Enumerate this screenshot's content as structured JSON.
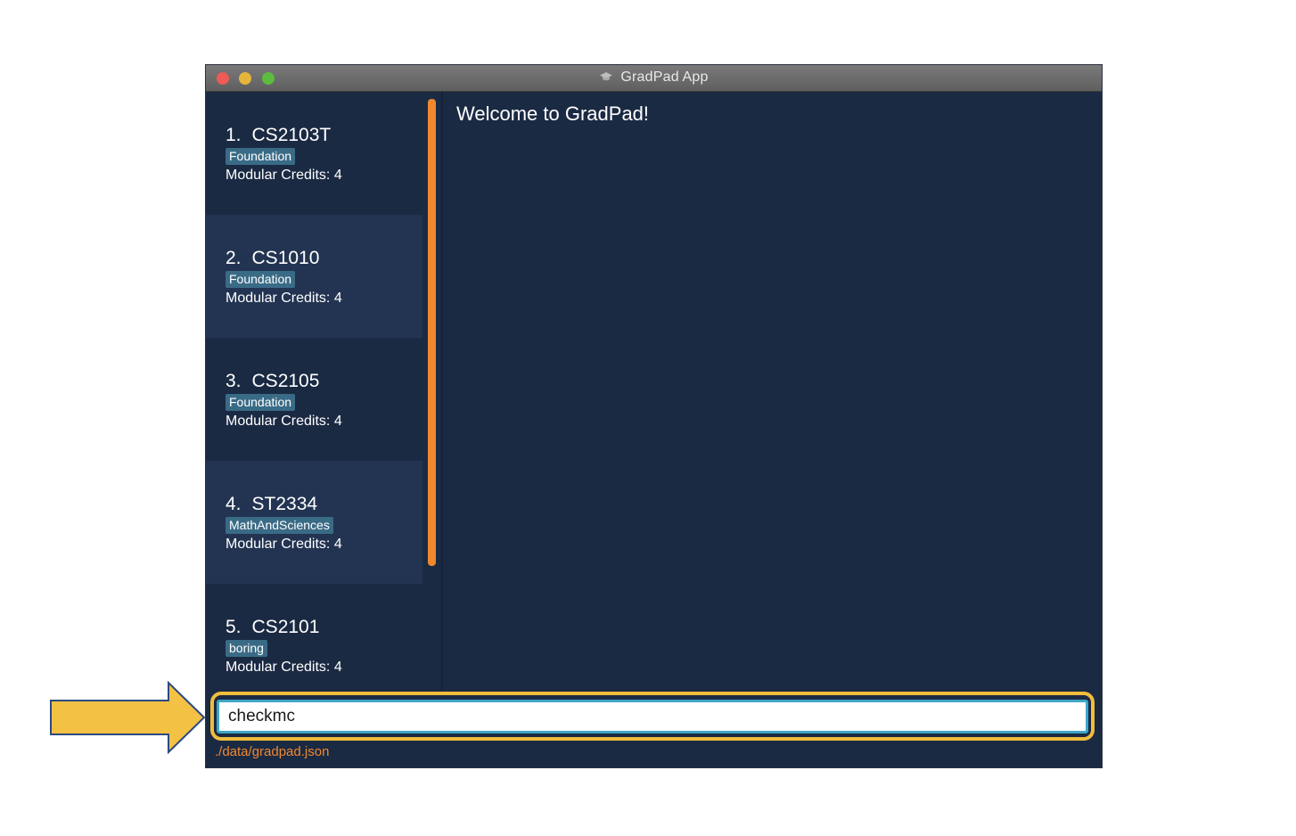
{
  "window": {
    "title": "GradPad App"
  },
  "modules": [
    {
      "index": "1.",
      "code": "CS2103T",
      "tag": "Foundation",
      "credits": "Modular Credits: 4"
    },
    {
      "index": "2.",
      "code": "CS1010",
      "tag": "Foundation",
      "credits": "Modular Credits: 4"
    },
    {
      "index": "3.",
      "code": "CS2105",
      "tag": "Foundation",
      "credits": "Modular Credits: 4"
    },
    {
      "index": "4.",
      "code": "ST2334",
      "tag": "MathAndSciences",
      "credits": "Modular Credits: 4"
    },
    {
      "index": "5.",
      "code": "CS2101",
      "tag": "boring",
      "credits": "Modular Credits: 4"
    }
  ],
  "result": {
    "message": "Welcome to GradPad!"
  },
  "command": {
    "value": "checkmc"
  },
  "status": {
    "file_path": "./data/gradpad.json"
  },
  "colors": {
    "background": "#1b2a43",
    "card_alt": "#233452",
    "tag": "#3a6b86",
    "scrollbar": "#f0882e",
    "highlight": "#f0bd3c",
    "input_border": "#3fa6c6"
  }
}
